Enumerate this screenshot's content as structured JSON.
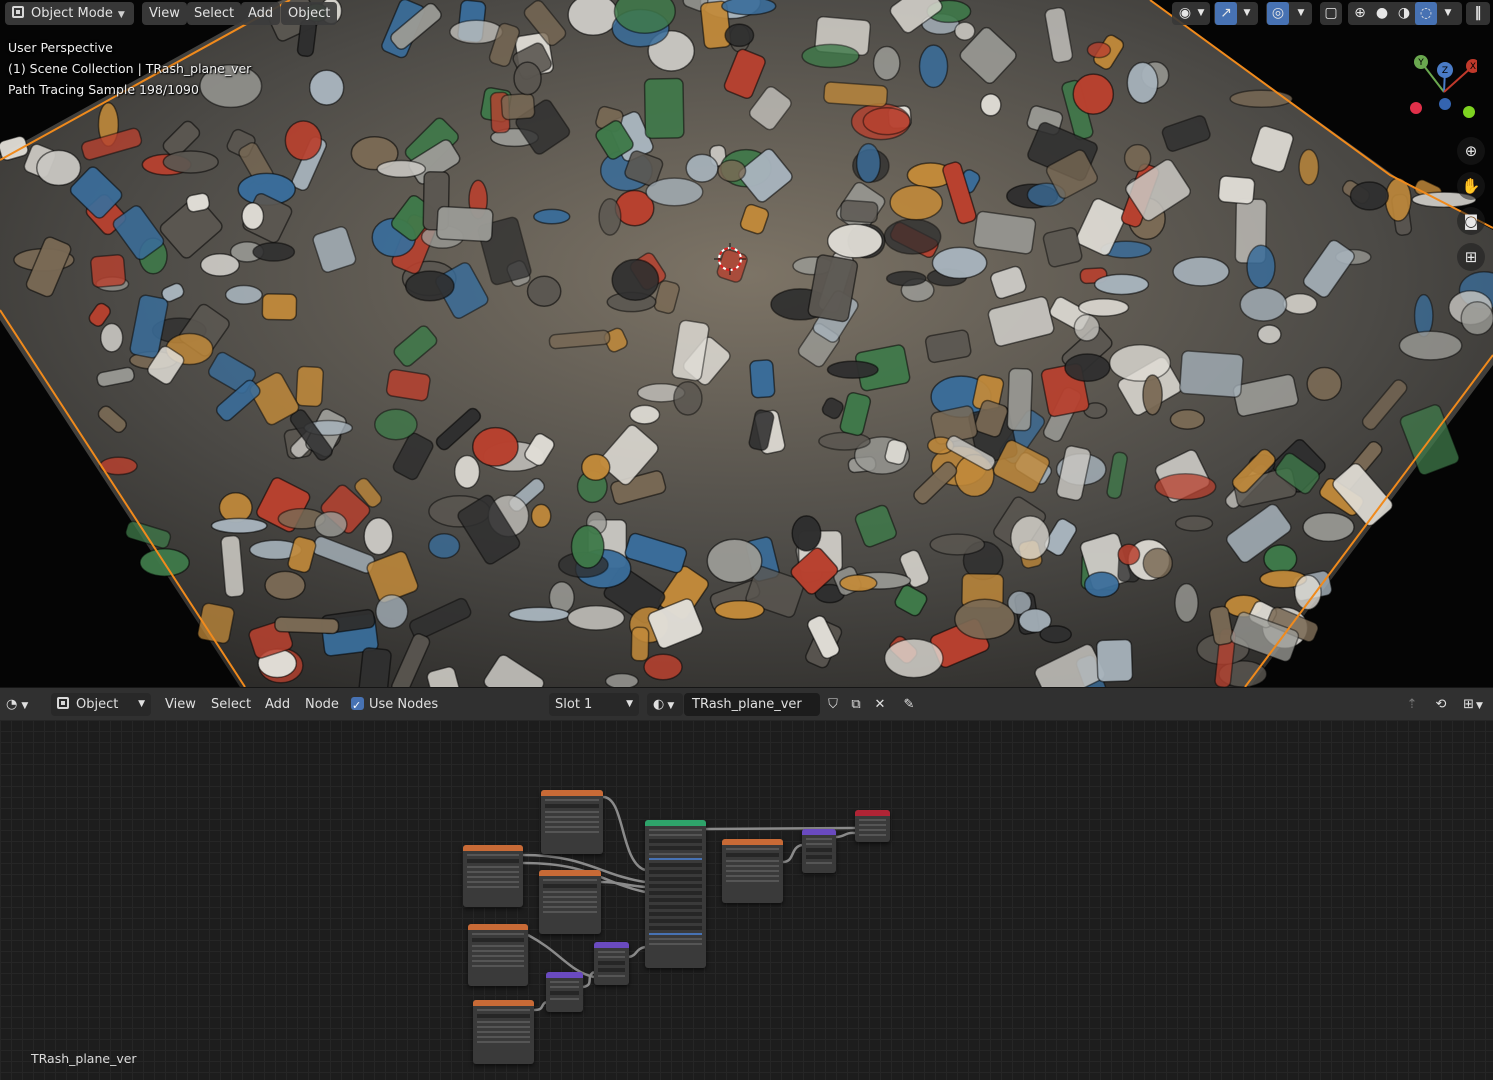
{
  "viewport": {
    "header": {
      "mode": "Object Mode",
      "menus": [
        "View",
        "Select",
        "Add",
        "Object"
      ]
    },
    "overlay": {
      "perspective": "User Perspective",
      "collection": "(1) Scene Collection | TRash_plane_ver",
      "sampling": "Path Tracing Sample 198/1090"
    },
    "gizmo_axes": {
      "y": "Y",
      "z": "Z",
      "x": "X"
    }
  },
  "node_editor": {
    "header": {
      "object_dropdown": "Object",
      "menus": [
        "View",
        "Select",
        "Add",
        "Node"
      ],
      "use_nodes_label": "Use Nodes",
      "use_nodes_checked": true,
      "slot": "Slot 1",
      "material_name": "TRash_plane_ver"
    },
    "material_label": "TRash_plane_ver"
  },
  "colors": {
    "accent": "#4772b3",
    "camera_frame": "#f08a1c",
    "texture_node_header": "#c86a36",
    "shader_node_header": "#2ea36a",
    "output_node_header": "#b02435",
    "vector_node_header": "#6a4ac0"
  }
}
